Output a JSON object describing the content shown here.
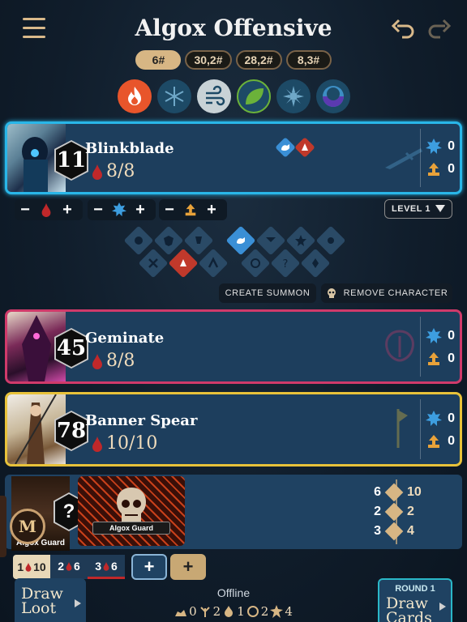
{
  "header": {
    "title": "Algox Offensive",
    "scenario_levels": [
      "6#",
      "30,2#",
      "28,2#",
      "8,3#"
    ]
  },
  "elements": [
    {
      "name": "fire",
      "color": "#e8552b"
    },
    {
      "name": "ice",
      "color": "#1d4a66"
    },
    {
      "name": "air",
      "color": "#c8d2d6"
    },
    {
      "name": "earth",
      "color": "#6bb23a"
    },
    {
      "name": "light",
      "color": "#1d4a66"
    },
    {
      "name": "dark",
      "color": "#4a3aa8"
    }
  ],
  "characters": [
    {
      "name": "Blinkblade",
      "initiative": "11",
      "hp": "8/8",
      "shield": "0",
      "xp": "0",
      "border": "#29b6e8"
    },
    {
      "name": "Geminate",
      "initiative": "45",
      "hp": "8/8",
      "shield": "0",
      "xp": "0",
      "border": "#d03a6a"
    },
    {
      "name": "Banner Spear",
      "initiative": "78",
      "hp": "10/10",
      "shield": "0",
      "xp": "0",
      "border": "#e8c23a"
    }
  ],
  "controls": {
    "minus": "−",
    "plus": "+",
    "level_label": "LEVEL 1",
    "create_summon": "CREATE SUMMON",
    "remove_character": "REMOVE CHARACTER"
  },
  "monster": {
    "initiative": "?",
    "name": "Algox Guard",
    "portrait_label": "Algox Guard",
    "stats": [
      {
        "normal": "6",
        "elite": "10"
      },
      {
        "normal": "2",
        "elite": "2"
      },
      {
        "normal": "3",
        "elite": "4"
      }
    ],
    "standees": [
      {
        "number": "1",
        "hp": "10",
        "elite": true
      },
      {
        "number": "2",
        "hp": "6",
        "elite": false
      },
      {
        "number": "3",
        "hp": "6",
        "elite": false
      }
    ],
    "add_normal": "+",
    "add_elite": "+"
  },
  "footer": {
    "draw_loot_1": "Draw",
    "draw_loot_2": "Loot",
    "status": "Offline",
    "round_label": "ROUND 1",
    "draw_cards_1": "Draw",
    "draw_cards_2": "Cards",
    "element_counts": [
      "0",
      "2",
      "1",
      "2",
      "4"
    ]
  }
}
